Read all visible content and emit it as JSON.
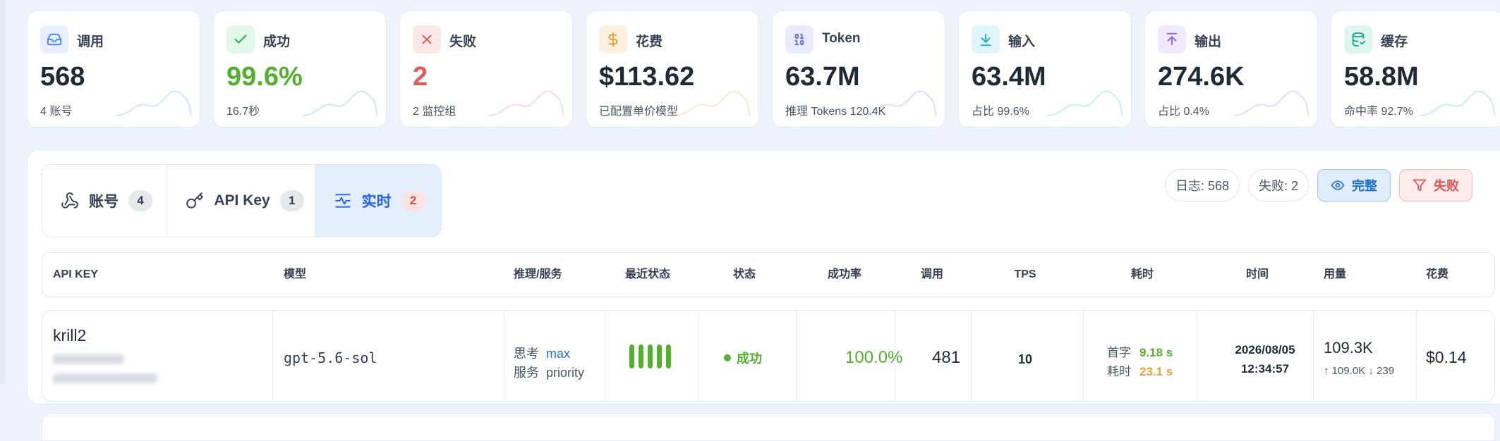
{
  "stats": [
    {
      "label": "调用",
      "value": "568",
      "sub": "4 账号",
      "icon": "inbox-icon",
      "color": "#3b82f6",
      "bg": "#e8f0fe"
    },
    {
      "label": "成功",
      "value": "99.6%",
      "sub": "16.7秒",
      "icon": "check-icon",
      "color": "#22a860",
      "bg": "#e3f6ea"
    },
    {
      "label": "失败",
      "value": "2",
      "sub": "2 监控组",
      "icon": "x-icon",
      "color": "#e25b5b",
      "bg": "#fde8e8"
    },
    {
      "label": "花费",
      "value": "$113.62",
      "sub": "已配置单价模型",
      "icon": "dollar-icon",
      "color": "#e39c2e",
      "bg": "#fdf1de"
    },
    {
      "label": "Token",
      "value": "63.7M",
      "sub": "推理 Tokens 120.4K",
      "icon": "binary-icon",
      "color": "#6366f1",
      "bg": "#ebeafd"
    },
    {
      "label": "输入",
      "value": "63.4M",
      "sub": "占比 99.6%",
      "icon": "download-icon",
      "color": "#14a9c8",
      "bg": "#e0f5fa"
    },
    {
      "label": "输出",
      "value": "274.6K",
      "sub": "占比 0.4%",
      "icon": "upload-icon",
      "color": "#8b5cf6",
      "bg": "#f1e9fd"
    },
    {
      "label": "缓存",
      "value": "58.8M",
      "sub": "命中率 92.7%",
      "icon": "database-icon",
      "color": "#18a889",
      "bg": "#dff5ef"
    }
  ],
  "colors": {
    "success": "#52b02c",
    "danger": "#e25b5b",
    "primary": "#2563eb",
    "warning": "#e6a23c"
  },
  "tabs": [
    {
      "label": "账号",
      "count": "4",
      "icon": "webhook-icon"
    },
    {
      "label": "API Key",
      "count": "1",
      "icon": "key-icon"
    },
    {
      "label": "实时",
      "count": "2",
      "icon": "activity-icon",
      "active": true
    }
  ],
  "filters": {
    "logs": "日志: 568",
    "failed": "失败: 2",
    "full_btn": "完整",
    "fail_btn": "失败"
  },
  "table": {
    "headers": [
      "API KEY",
      "模型",
      "推理/服务",
      "最近状态",
      "状态",
      "成功率",
      "调用",
      "TPS",
      "耗时",
      "时间",
      "用量",
      "花费"
    ],
    "rows": [
      {
        "key_name": "krill2",
        "model": "gpt-5.6-sol",
        "reasoning_label": "思考",
        "reasoning_value": "max",
        "service_label": "服务",
        "service_value": "priority",
        "recent_status_bars": 5,
        "status": "成功",
        "success_rate": "100.0%",
        "calls": "481",
        "tps": "10",
        "first_token_label": "首字",
        "first_token_value": "9.18 s",
        "elapsed_label": "耗时",
        "elapsed_value": "23.1 s",
        "date": "2026/08/05",
        "time": "12:34:57",
        "usage": "109.3K",
        "usage_detail": "↑ 109.0K  ↓ 239",
        "cost": "$0.14"
      }
    ]
  }
}
